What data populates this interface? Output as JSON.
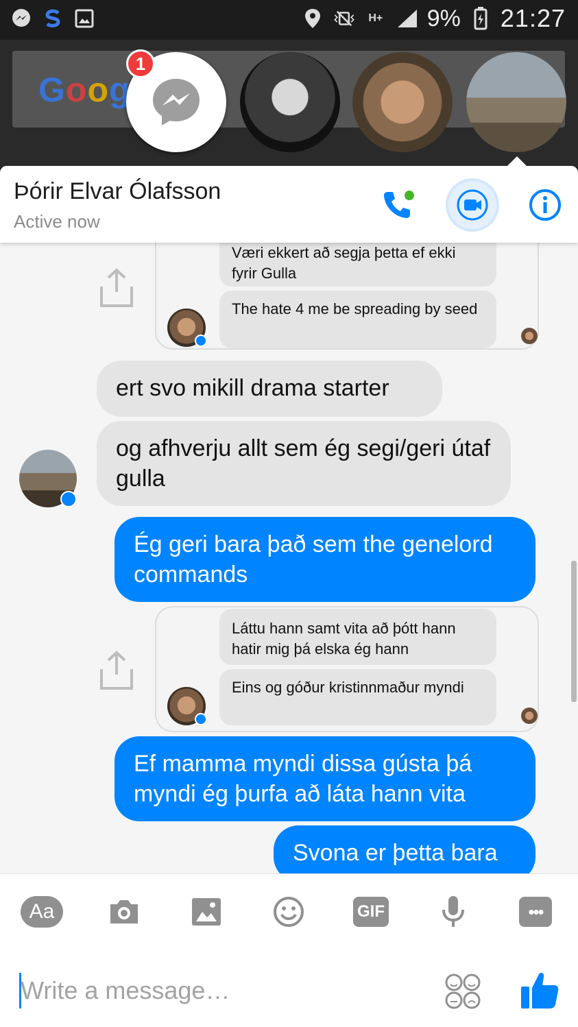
{
  "status_bar": {
    "battery": "9%",
    "time": "21:27",
    "network": "H+"
  },
  "chat_heads": {
    "badge_count": "1",
    "google_logo": "Googl"
  },
  "header": {
    "contact_name": "Þórir Elvar Ólafsson",
    "status": "Active now"
  },
  "messages": {
    "card1": {
      "line1": "Væri ekkert að segja þetta ef ekki fyrir Gulla",
      "line2": "The hate 4 me be spreading by seed"
    },
    "in1": "ert svo mikill drama starter",
    "in2": "og afhverju allt sem ég segi/geri útaf gulla",
    "out1": "Ég geri bara það sem the genelord commands",
    "card2": {
      "line1": "Láttu hann samt vita að þótt hann hatir mig þá elska ég hann",
      "line2": "Eins og góður kristinnmaður myndi"
    },
    "out2": "Ef mamma myndi dissa gústa þá myndi ég þurfa að láta hann vita",
    "out3": "Svona er þetta bara"
  },
  "composer": {
    "aa_label": "Aa",
    "gif_label": "GIF",
    "more_label": "•••",
    "placeholder": "Write a message…"
  },
  "colors": {
    "accent": "#0084ff",
    "bubble_in": "#e4e4e4",
    "badge": "#f03b3b",
    "online": "#42b72a"
  }
}
